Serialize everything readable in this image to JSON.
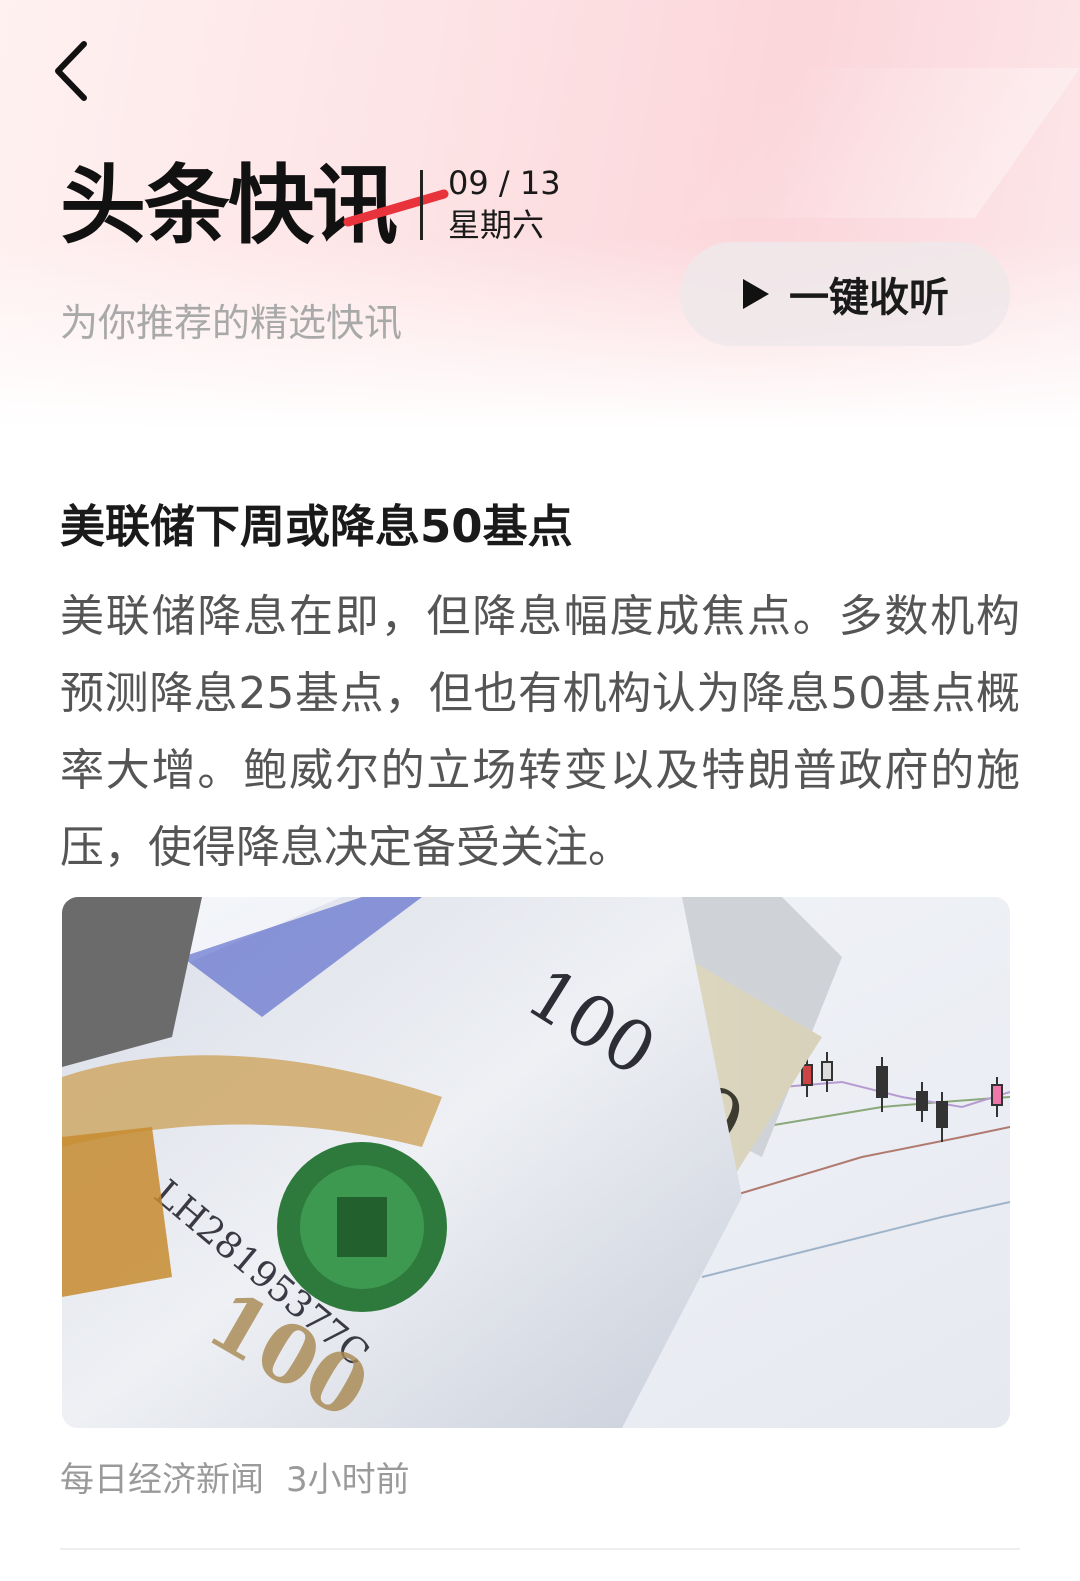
{
  "header": {
    "logo_text": "头条快讯",
    "date": "09 / 13",
    "weekday": "星期六",
    "subtitle": "为你推荐的精选快讯",
    "listen_label": "一键收听"
  },
  "article": {
    "title": "美联储下周或降息50基点",
    "summary": "美联储降息在即，但降息幅度成焦点。多数机构预测降息25基点，但也有机构认为降息50基点概率大增。鲍威尔的立场转变以及特朗普政府的施压，使得降息决定备受关注。",
    "source": "每日经济新闻",
    "time_ago": "3小时前",
    "image_alt": "US dollar banknotes over a stock chart"
  },
  "icons": {
    "back": "chevron-left-icon",
    "play": "play-icon"
  },
  "colors": {
    "accent_red": "#e8323c",
    "header_pink": "#fbd6da",
    "button_bg": "#f0e8ea"
  }
}
